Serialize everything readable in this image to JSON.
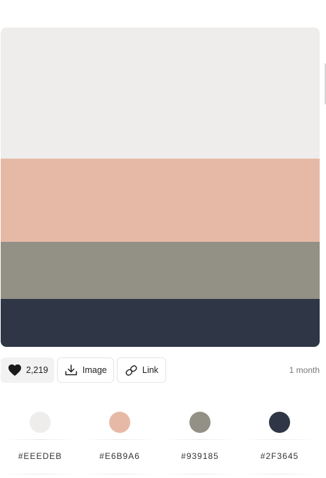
{
  "palette": {
    "colors": [
      {
        "hex": "#EEEDEB",
        "value": "#EEEDEB",
        "share": 0.41
      },
      {
        "hex": "#E6B9A6",
        "value": "#E6B9A6",
        "share": 0.26
      },
      {
        "hex": "#939185",
        "value": "#939185",
        "share": 0.18
      },
      {
        "hex": "#2F3645",
        "value": "#2F3645",
        "share": 0.15
      }
    ]
  },
  "actions": {
    "likes": "2,219",
    "image_label": "Image",
    "link_label": "Link",
    "heart_icon": "heart-icon",
    "download_icon": "download-icon",
    "link_icon": "link-icon"
  },
  "meta": {
    "age": "1 month"
  }
}
